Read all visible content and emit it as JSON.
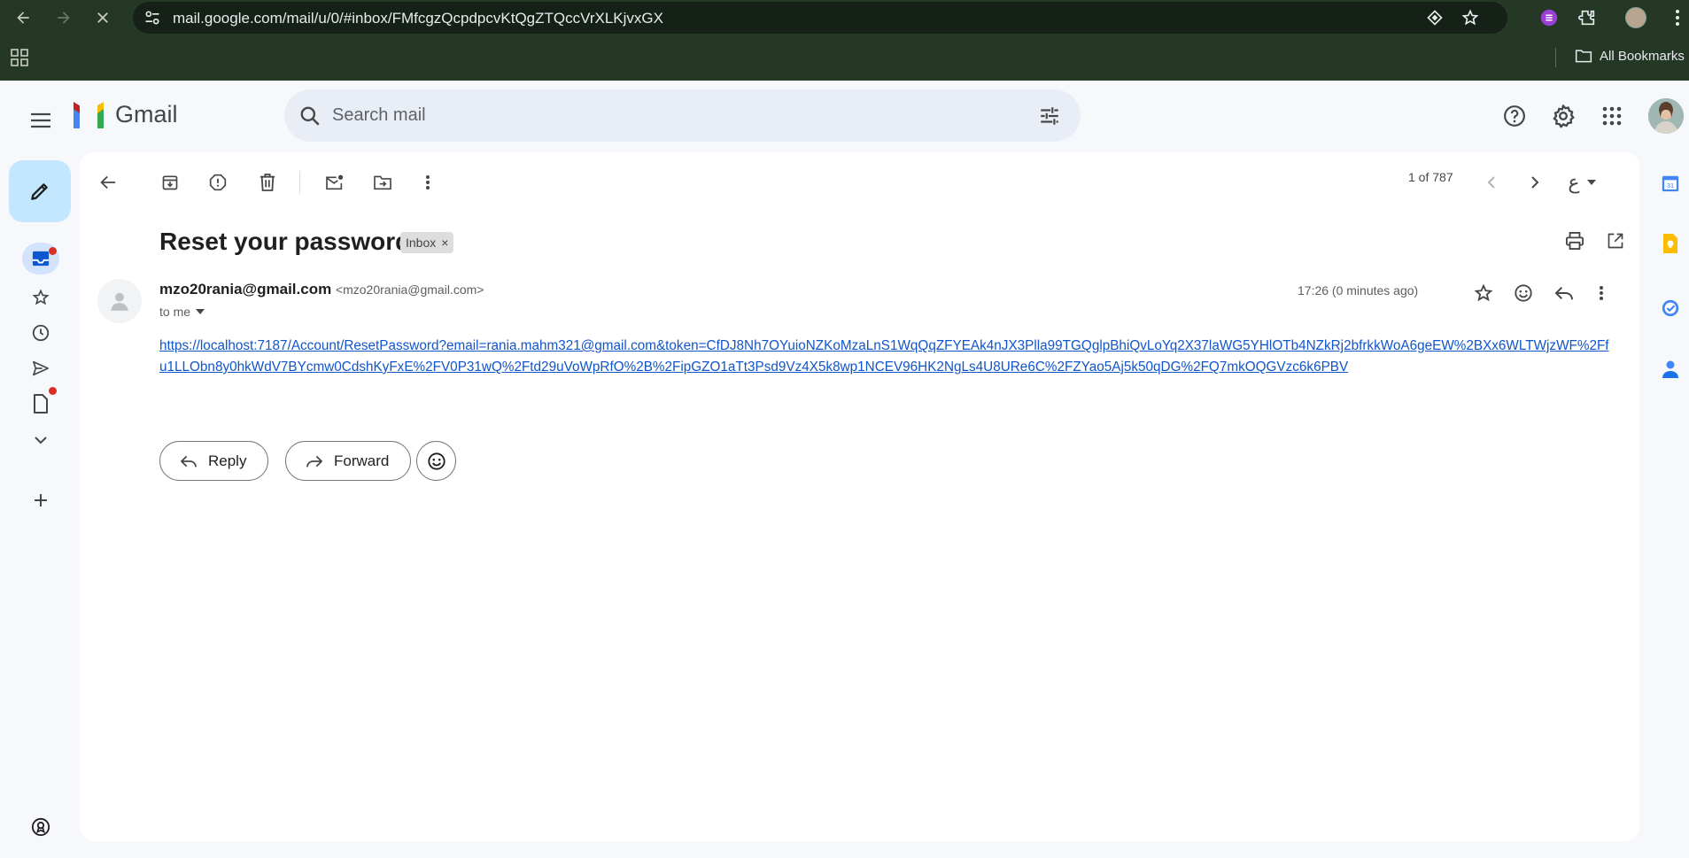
{
  "browser": {
    "url": "mail.google.com/mail/u/0/#inbox/FMfcgzQcpdpcvKtQgZTQccVrXLKjvxGX",
    "bookmarks_label": "All Bookmarks"
  },
  "gmail": {
    "brand": "Gmail",
    "search_placeholder": "Search mail"
  },
  "toolbar": {
    "pager": "1 of 787",
    "lang_glyph": "ع"
  },
  "email": {
    "subject": "Reset your password",
    "label": "Inbox",
    "label_remove": "×",
    "sender_name": "mzo20rania@gmail.com",
    "sender_email": "<mzo20rania@gmail.com>",
    "recipient": "to me",
    "time": "17:26 (0 minutes ago)",
    "link": "https://localhost:7187/Account/ResetPassword?email=rania.mahm321@gmail.com&token=CfDJ8Nh7OYuioNZKoMzaLnS1WqQqZFYEAk4nJX3Plla99TGQglpBhiQvLoYq2X37laWG5YHlOTb4NZkRj2bfrkkWoA6geEW%2BXx6WLTWjzWF%2Ffu1LLObn8y0hkWdV7BYcmw0CdshKyFxE%2FV0P31wQ%2Ftd29uVoWpRfO%2B%2FipGZO1aTt3Psd9Vz4X5k8wp1NCEV96HK2NgLs4U8URe6C%2FZYao5Aj5k50qDG%2FQ7mkOQGVzc6k6PBV"
  },
  "actions": {
    "reply": "Reply",
    "forward": "Forward"
  },
  "colors": {
    "chrome_bg": "#253826",
    "compose_bg": "#c2e7ff",
    "link": "#1155cc",
    "notification_dot": "#d93025"
  }
}
